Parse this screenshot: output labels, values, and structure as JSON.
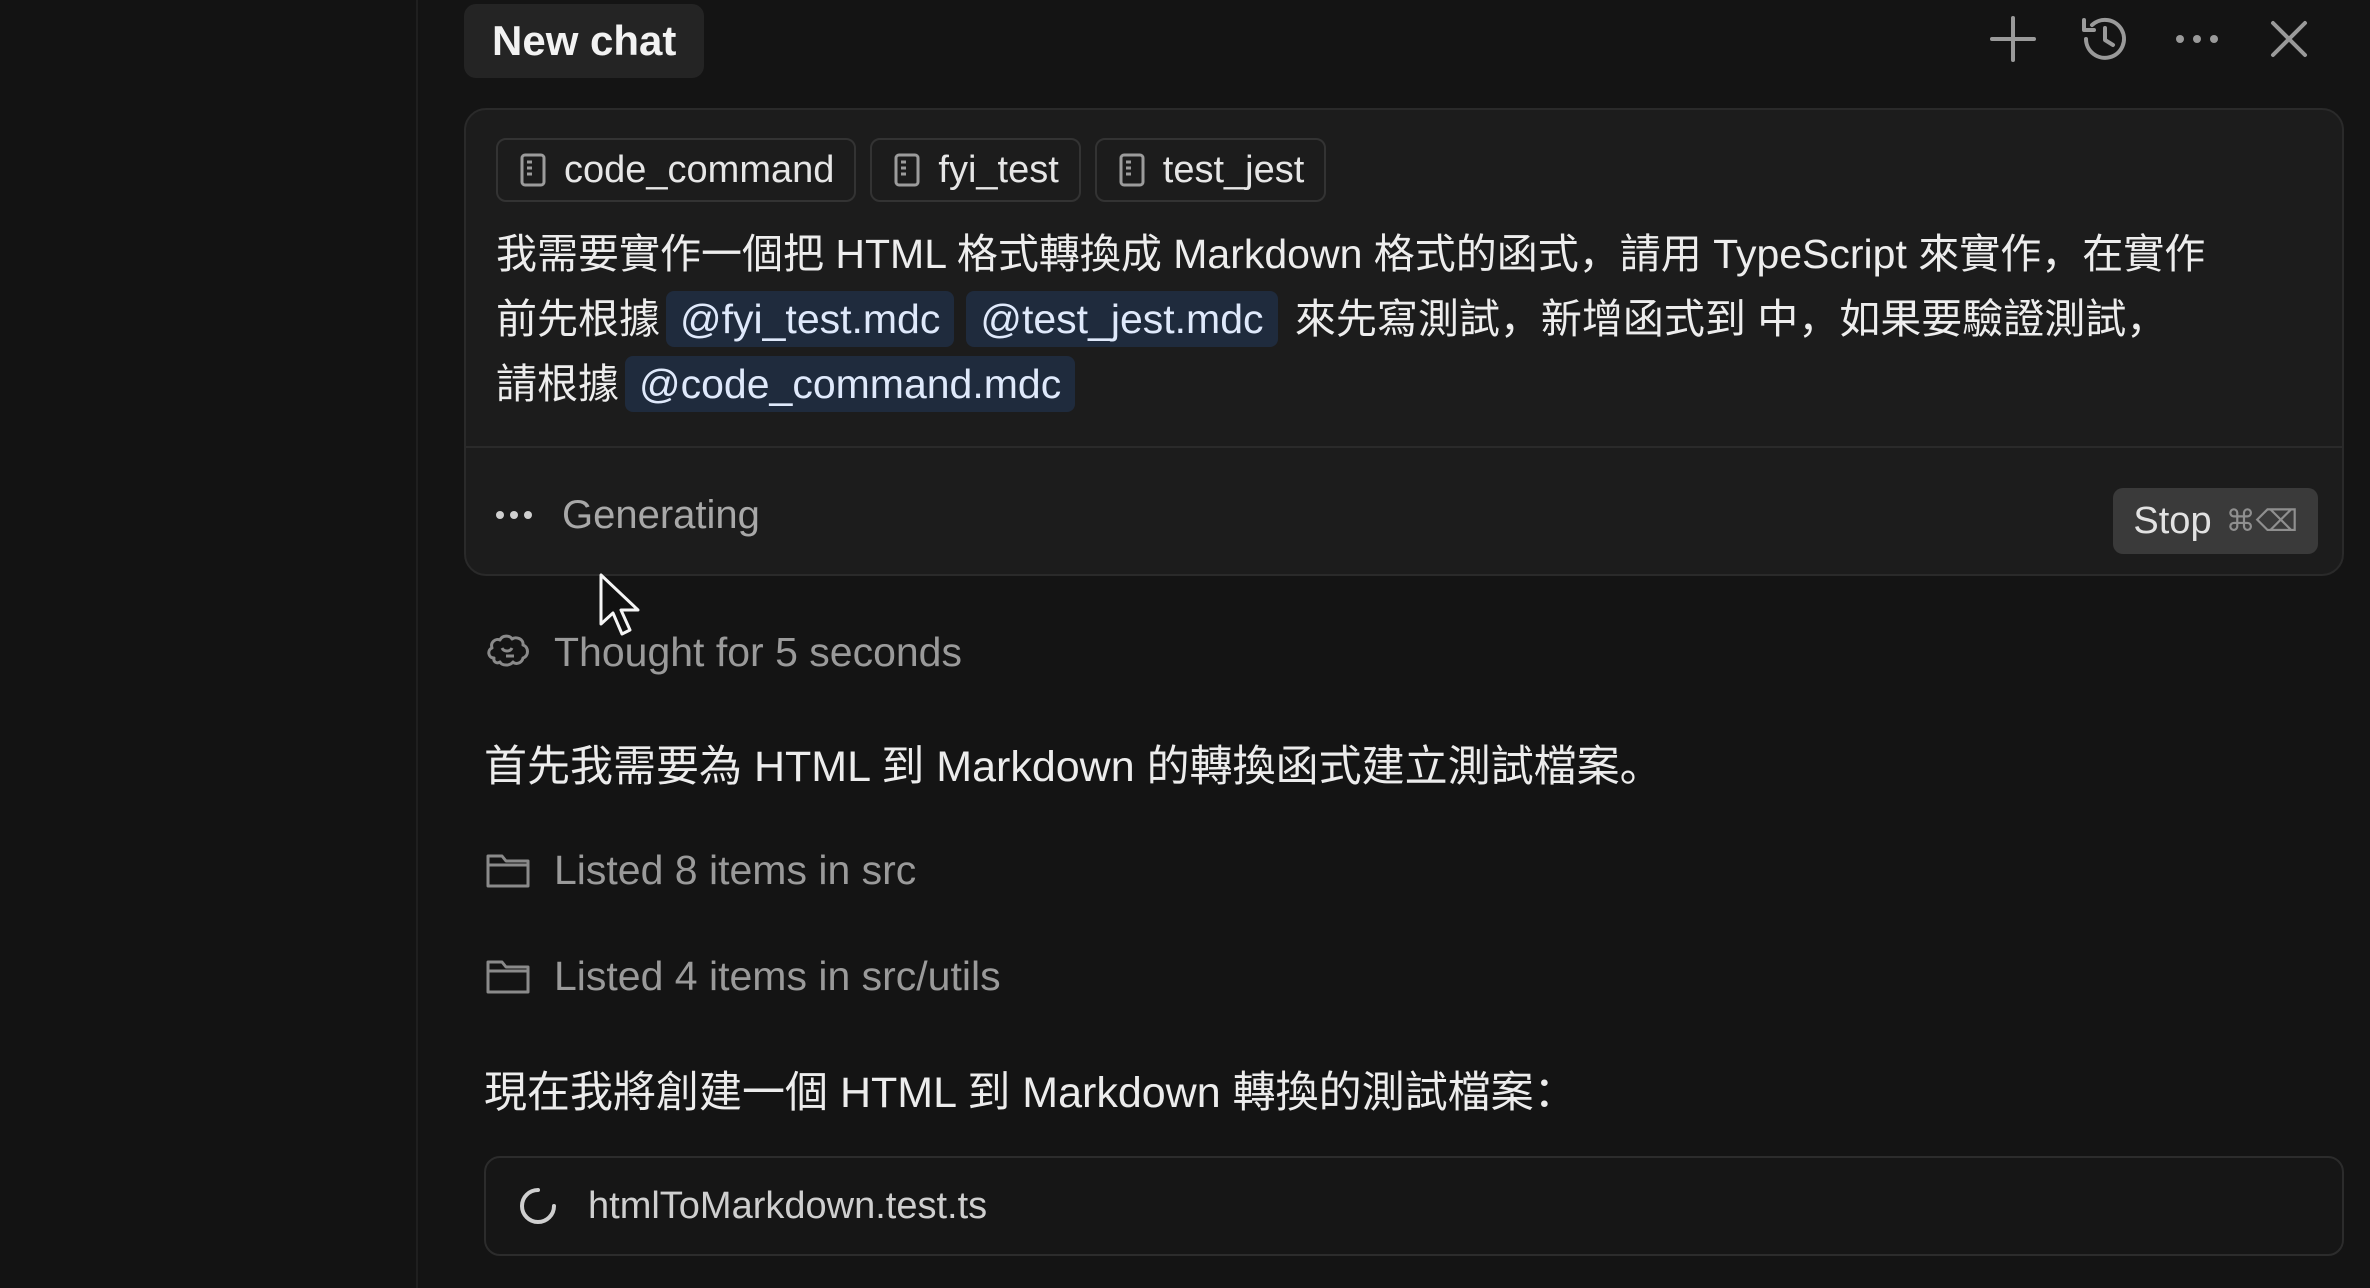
{
  "header": {
    "tab_title": "New chat",
    "icons": [
      "plus-icon",
      "history-icon",
      "more-icon",
      "close-icon"
    ]
  },
  "composer": {
    "chips": [
      {
        "label": "code_command",
        "icon": "file-icon"
      },
      {
        "label": "fyi_test",
        "icon": "file-icon"
      },
      {
        "label": "test_jest",
        "icon": "file-icon"
      }
    ],
    "prompt": {
      "line1": "我需要實作一個把 HTML 格式轉換成 Markdown 格式的函式，請用 TypeScript 來實作，在實作",
      "line2_prefix": "前先根據",
      "mention1": "@fyi_test.mdc",
      "mention2": "@test_jest.mdc",
      "line2_suffix": "來先寫測試，新增函式到 中，如果要驗證測試，",
      "line3_prefix": "請根據",
      "mention3": "@code_command.mdc"
    },
    "status_text": "Generating",
    "stop_label": "Stop",
    "stop_shortcut": "⌘⌫"
  },
  "conversation": {
    "thought": "Thought for 5 seconds",
    "message1": "首先我需要為 HTML 到 Markdown 的轉換函式建立測試檔案。",
    "listed1": "Listed 8 items in src",
    "listed2": "Listed 4 items in src/utils",
    "message2": "現在我將創建一個 HTML 到 Markdown 轉換的測試檔案：",
    "file_card": "htmlToMarkdown.test.ts"
  },
  "colors": {
    "background": "#131313",
    "panel": "#1c1c1c",
    "mention_bg": "#1f2b3d",
    "stop_bg": "#3a3a3a"
  }
}
